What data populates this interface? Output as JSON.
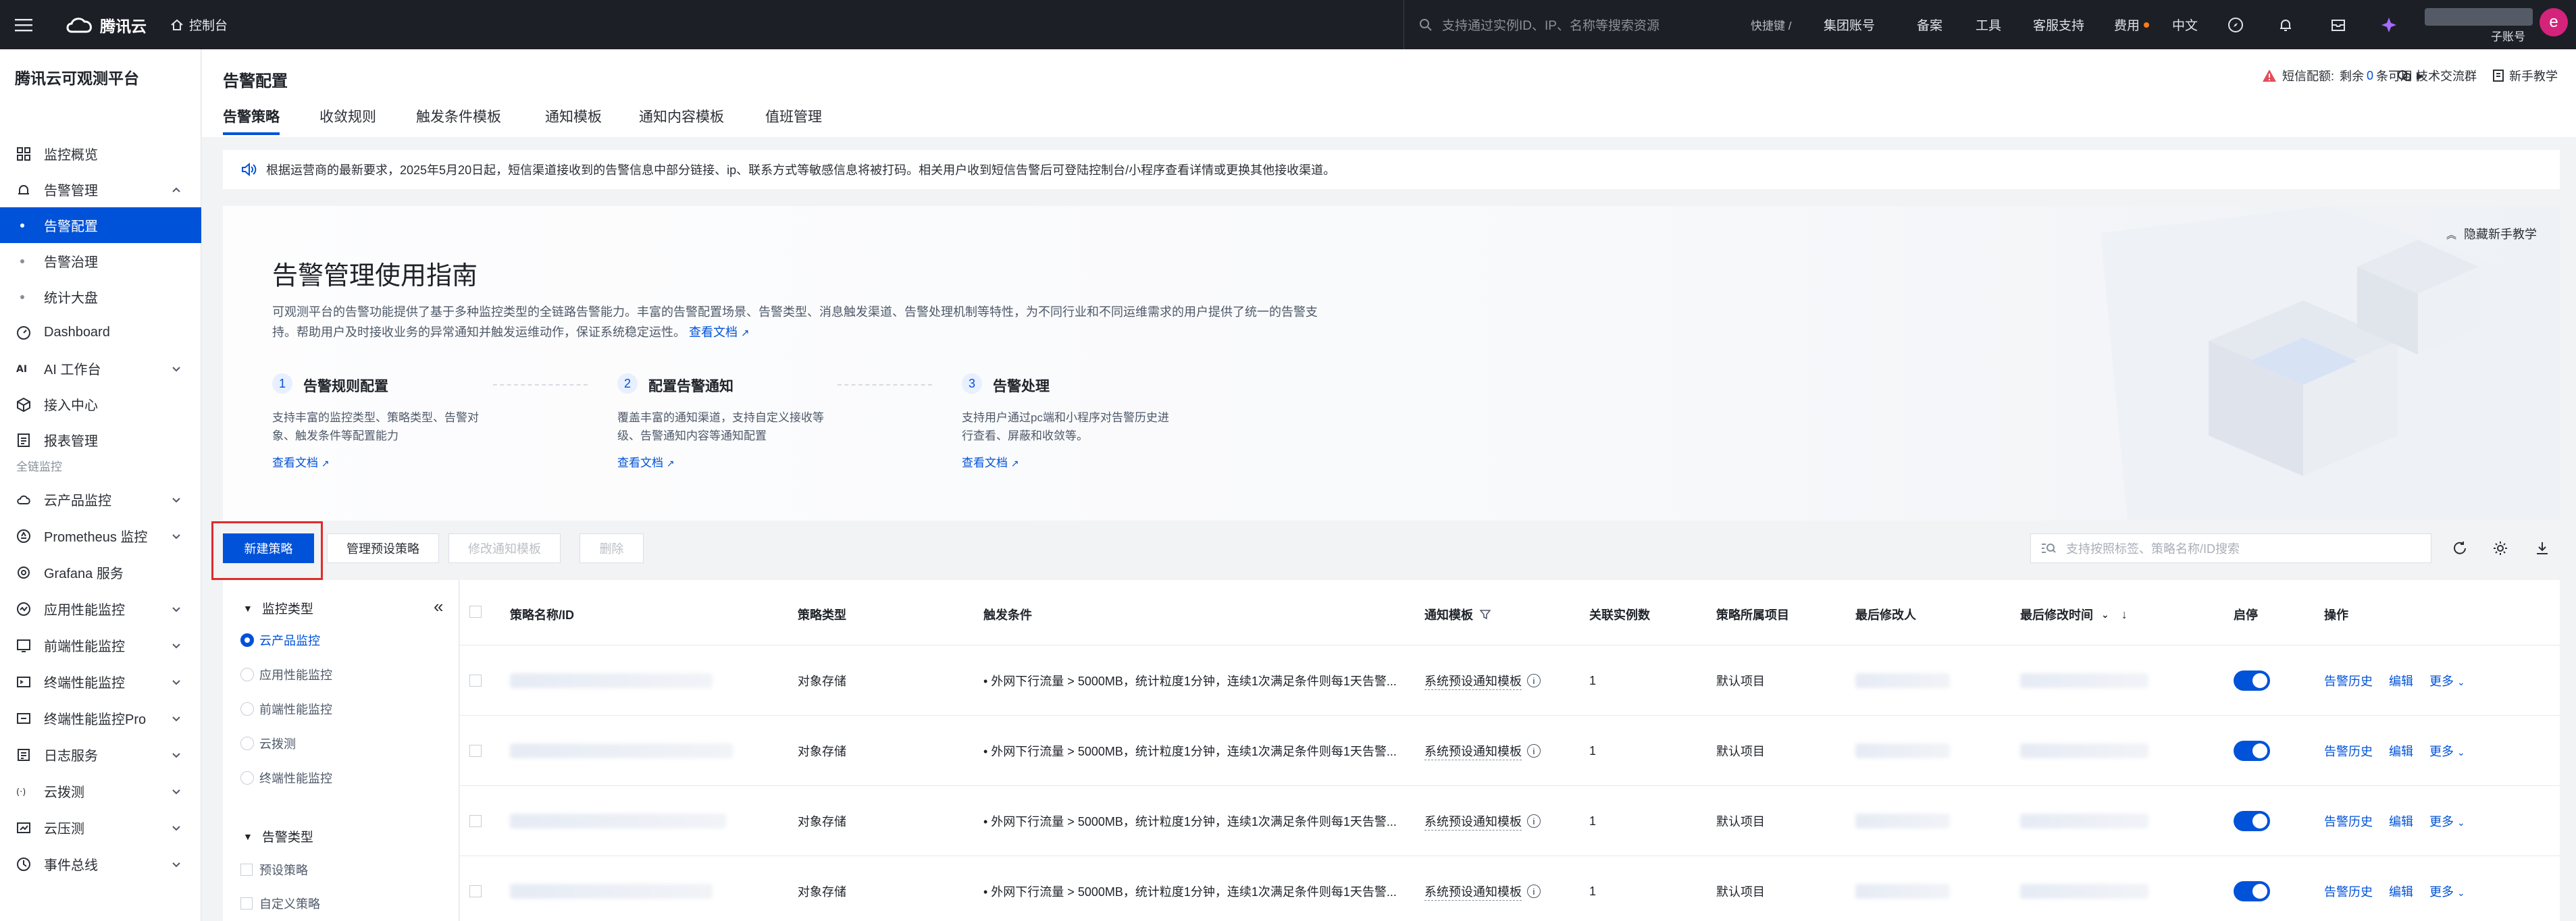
{
  "topbar": {
    "brand": "腾讯云",
    "console": "控制台",
    "search_placeholder": "支持通过实例ID、IP、名称等搜索资源",
    "shortcut": "快捷键 /",
    "nav": [
      "集团账号",
      "备案",
      "工具",
      "客服支持",
      "费用",
      "中文"
    ],
    "user_sub": "子账号",
    "avatar_letter": "e"
  },
  "sidebar": {
    "title": "腾讯云可观测平台",
    "items": [
      {
        "label": "监控概览",
        "icon": "dashboard-grid-icon"
      },
      {
        "label": "告警管理",
        "icon": "alarm-icon",
        "expanded": true
      },
      {
        "label": "告警配置",
        "sub": true,
        "active": true
      },
      {
        "label": "告警治理",
        "sub": true
      },
      {
        "label": "统计大盘",
        "sub": true
      },
      {
        "label": "Dashboard",
        "icon": "dashboard-icon"
      },
      {
        "label": "AI 工作台",
        "icon": "ai-icon",
        "chevron": true
      },
      {
        "label": "接入中心",
        "icon": "box-icon"
      },
      {
        "label": "报表管理",
        "icon": "report-icon"
      }
    ],
    "group_label": "全链监控",
    "group_items": [
      {
        "label": "云产品监控",
        "icon": "cloud-icon",
        "chevron": true
      },
      {
        "label": "Prometheus 监控",
        "icon": "prometheus-icon",
        "chevron": true
      },
      {
        "label": "Grafana 服务",
        "icon": "grafana-icon"
      },
      {
        "label": "应用性能监控",
        "icon": "apm-icon",
        "chevron": true
      },
      {
        "label": "前端性能监控",
        "icon": "frontend-icon",
        "chevron": true
      },
      {
        "label": "终端性能监控",
        "icon": "terminal-icon",
        "chevron": true
      },
      {
        "label": "终端性能监控Pro",
        "icon": "terminal-pro-icon",
        "chevron": true
      },
      {
        "label": "日志服务",
        "icon": "log-icon",
        "chevron": true
      },
      {
        "label": "云拨测",
        "icon": "probe-icon",
        "chevron": true
      },
      {
        "label": "云压测",
        "icon": "stress-icon",
        "chevron": true
      },
      {
        "label": "事件总线",
        "icon": "event-bus-icon",
        "chevron": true
      }
    ]
  },
  "header": {
    "title": "告警配置",
    "tabs": [
      "告警策略",
      "收敛规则",
      "触发条件模板",
      "通知模板",
      "通知内容模板",
      "值班管理"
    ],
    "sms_label": "短信配额:",
    "sms_remaining": "剩余",
    "sms_count": "0",
    "sms_unit": "条可用",
    "tech_group": "技术交流群",
    "tutorial": "新手教学"
  },
  "notice": {
    "text": "根据运营商的最新要求，2025年5月20日起，短信渠道接收到的告警信息中部分链接、ip、联系方式等敏感信息将被打码。相关用户收到短信告警后可登陆控制台/小程序查看详情或更换其他接收渠道。"
  },
  "guide": {
    "hide": "隐藏新手教学",
    "title": "告警管理使用指南",
    "desc": "可观测平台的告警功能提供了基于多种监控类型的全链路告警能力。丰富的告警配置场景、告警类型、消息触发渠道、告警处理机制等特性，为不同行业和不同运维需求的用户提供了统一的告警支持。帮助用户及时接收业务的异常通知并触发运维动作，保证系统稳定运性。",
    "doc_link": "查看文档",
    "steps": [
      {
        "num": "1",
        "title": "告警规则配置",
        "desc": "支持丰富的监控类型、策略类型、告警对象、触发条件等配置能力",
        "link": "查看文档"
      },
      {
        "num": "2",
        "title": "配置告警通知",
        "desc": "覆盖丰富的通知渠道，支持自定义接收等级、告警通知内容等通知配置",
        "link": "查看文档"
      },
      {
        "num": "3",
        "title": "告警处理",
        "desc": "支持用户通过pc端和小程序对告警历史进行查看、屏蔽和收敛等。",
        "link": "查看文档"
      }
    ]
  },
  "toolbar": {
    "new": "新建策略",
    "manage_preset": "管理预设策略",
    "modify_template": "修改通知模板",
    "delete": "删除",
    "search_placeholder": "支持按照标签、策略名称/ID搜索"
  },
  "filter": {
    "monitor_type": "监控类型",
    "monitor_options": [
      "云产品监控",
      "应用性能监控",
      "前端性能监控",
      "云拨测",
      "终端性能监控"
    ],
    "alarm_type": "告警类型",
    "alarm_options": [
      "预设策略",
      "自定义策略"
    ]
  },
  "table": {
    "columns": [
      "策略名称/ID",
      "策略类型",
      "触发条件",
      "通知模板",
      "关联实例数",
      "策略所属项目",
      "最后修改人",
      "最后修改时间",
      "启停",
      "操作"
    ],
    "rows": [
      {
        "type": "对象存储",
        "condition": "• 外网下行流量 > 5000MB，统计粒度1分钟，连续1次满足条件则每1天告警...",
        "template": "系统预设通知模板",
        "instances": "1",
        "project": "默认项目",
        "enabled": true
      },
      {
        "type": "对象存储",
        "condition": "• 外网下行流量 > 5000MB，统计粒度1分钟，连续1次满足条件则每1天告警...",
        "template": "系统预设通知模板",
        "instances": "1",
        "project": "默认项目",
        "enabled": true
      },
      {
        "type": "对象存储",
        "condition": "• 外网下行流量 > 5000MB，统计粒度1分钟，连续1次满足条件则每1天告警...",
        "template": "系统预设通知模板",
        "instances": "1",
        "project": "默认项目",
        "enabled": true
      },
      {
        "type": "对象存储",
        "condition": "• 外网下行流量 > 5000MB，统计粒度1分钟，连续1次满足条件则每1天告警...",
        "template": "系统预设通知模板",
        "instances": "1",
        "project": "默认项目",
        "enabled": true
      }
    ],
    "actions": [
      "告警历史",
      "编辑",
      "更多"
    ]
  },
  "colors": {
    "primary": "#0052d9",
    "topbar": "#1c1f26",
    "highlight": "#e02b2b",
    "avatar": "#d4237a"
  }
}
